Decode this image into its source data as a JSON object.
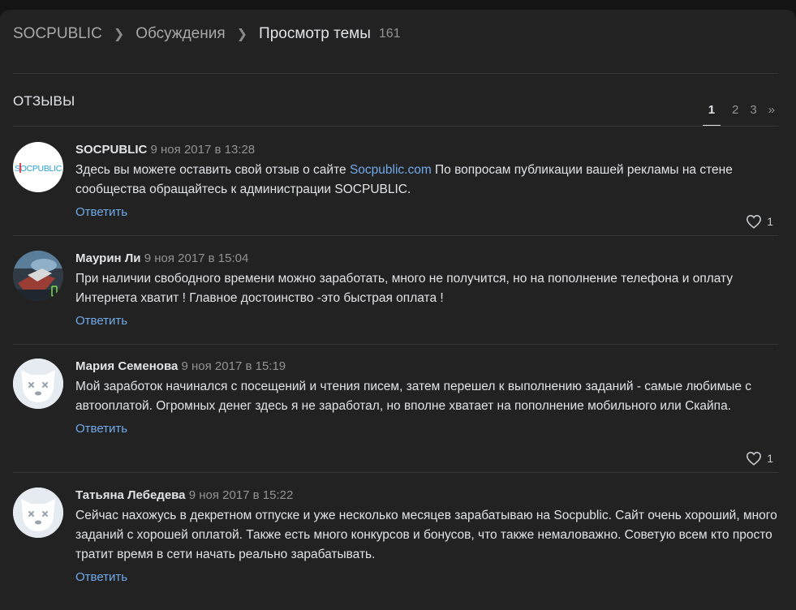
{
  "breadcrumb": {
    "root": "SOCPUBLIC",
    "section": "Обсуждения",
    "current": "Просмотр темы",
    "count": "161"
  },
  "section_title": "ОТЗЫВЫ",
  "pagination": {
    "pages": [
      "1",
      "2",
      "3"
    ],
    "active": "1",
    "next": "»"
  },
  "comments": [
    {
      "author": "SOCPUBLIC",
      "date": "9 ноя 2017 в 13:28",
      "text_before": "Здесь вы можете оставить свой отзыв о сайте ",
      "link": "Socpublic.com",
      "text_after": " По вопросам публикации вашей рекламы на стене сообщества обращайтесь к администрации SOCPUBLIC.",
      "reply": "Ответить",
      "likes": "1",
      "avatar_text": "SOCPUBLIC"
    },
    {
      "author": "Маурин Ли",
      "date": "9 ноя 2017 в 15:04",
      "text": "При наличии свободного времени можно заработать, много не получится, но на пополнение телефона и оплату Интернета хватит ! Главное достоинство -это быстрая оплата !",
      "reply": "Ответить"
    },
    {
      "author": "Мария Семенова",
      "date": "9 ноя 2017 в 15:19",
      "text": "Мой заработок начинался с посещений и чтения писем, затем перешел к выполнению заданий - самые любимые с автооплатой. Огромных денег здесь я не заработал, но вполне хватает на пополнение мобильного или Скайпа.",
      "reply": "Ответить",
      "likes": "1"
    },
    {
      "author": "Татьяна Лебедева",
      "date": "9 ноя 2017 в 15:22",
      "text": "Сейчас нахожусь в декретном отпуске и уже несколько месяцев зарабатываю на Socpublic. Сайт очень хороший, много заданий с хорошей оплатой. Также есть много конкурсов и бонусов, что также немаловажно. Советую всем кто просто тратит время в сети начать реально зарабатывать.",
      "reply": "Ответить"
    }
  ]
}
